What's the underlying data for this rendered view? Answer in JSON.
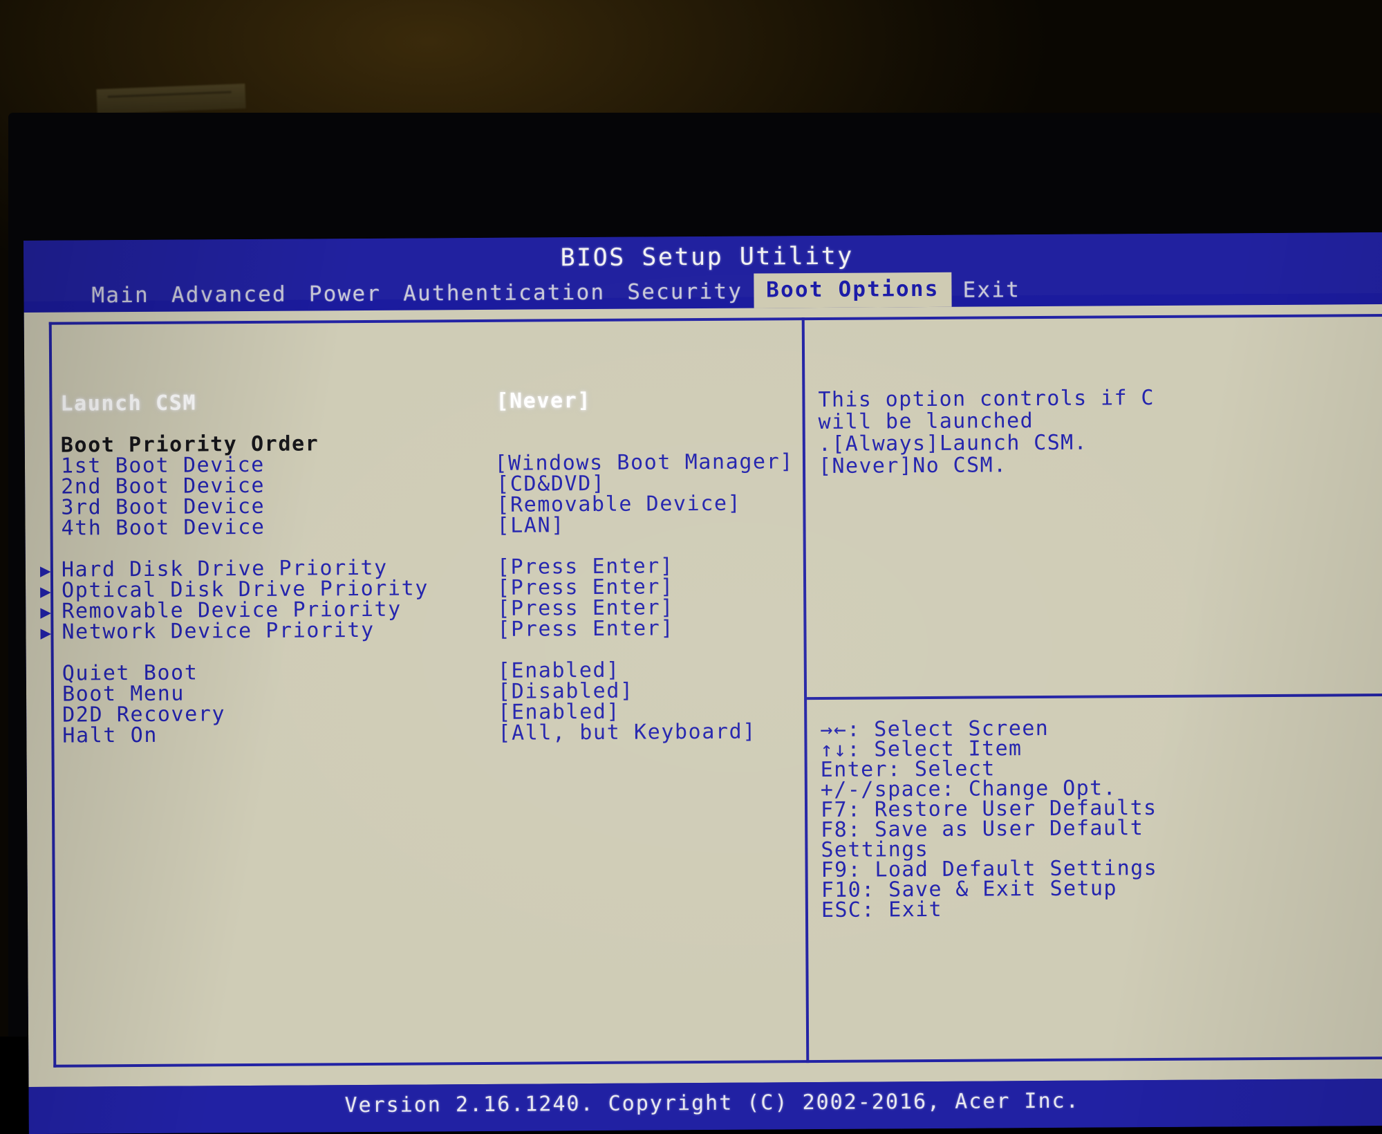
{
  "title": "BIOS Setup Utility",
  "menu": {
    "items": [
      {
        "label": "Main",
        "active": false
      },
      {
        "label": "Advanced",
        "active": false
      },
      {
        "label": "Power",
        "active": false
      },
      {
        "label": "Authentication",
        "active": false
      },
      {
        "label": "Security",
        "active": false
      },
      {
        "label": "Boot Options",
        "active": true
      },
      {
        "label": "Exit",
        "active": false
      }
    ]
  },
  "settings": [
    {
      "label": "Launch CSM",
      "value": "[Never]",
      "kind": "option",
      "selected": true,
      "submenu": false
    },
    {
      "label": "",
      "value": "",
      "kind": "spacer",
      "selected": false,
      "submenu": false
    },
    {
      "label": "Boot Priority Order",
      "value": "",
      "kind": "header",
      "selected": false,
      "submenu": false
    },
    {
      "label": "1st Boot Device",
      "value": "[Windows Boot Manager]",
      "kind": "option",
      "selected": false,
      "submenu": false
    },
    {
      "label": "2nd Boot Device",
      "value": "[CD&DVD]",
      "kind": "option",
      "selected": false,
      "submenu": false
    },
    {
      "label": "3rd Boot Device",
      "value": "[Removable Device]",
      "kind": "option",
      "selected": false,
      "submenu": false
    },
    {
      "label": "4th Boot Device",
      "value": "[LAN]",
      "kind": "option",
      "selected": false,
      "submenu": false
    },
    {
      "label": "",
      "value": "",
      "kind": "spacer",
      "selected": false,
      "submenu": false
    },
    {
      "label": "Hard Disk Drive Priority",
      "value": "[Press Enter]",
      "kind": "option",
      "selected": false,
      "submenu": true
    },
    {
      "label": "Optical Disk Drive Priority",
      "value": "[Press Enter]",
      "kind": "option",
      "selected": false,
      "submenu": true
    },
    {
      "label": "Removable Device Priority",
      "value": "[Press Enter]",
      "kind": "option",
      "selected": false,
      "submenu": true
    },
    {
      "label": "Network Device Priority",
      "value": "[Press Enter]",
      "kind": "option",
      "selected": false,
      "submenu": true
    },
    {
      "label": "",
      "value": "",
      "kind": "spacer",
      "selected": false,
      "submenu": false
    },
    {
      "label": "Quiet Boot",
      "value": "[Enabled]",
      "kind": "option",
      "selected": false,
      "submenu": false
    },
    {
      "label": "Boot Menu",
      "value": "[Disabled]",
      "kind": "option",
      "selected": false,
      "submenu": false
    },
    {
      "label": "D2D Recovery",
      "value": "[Enabled]",
      "kind": "option",
      "selected": false,
      "submenu": false
    },
    {
      "label": "Halt On",
      "value": "[All, but Keyboard]",
      "kind": "option",
      "selected": false,
      "submenu": false
    }
  ],
  "help": {
    "lines": [
      "This option controls if C",
      "will be launched",
      ".[Always]Launch CSM.",
      "[Never]No CSM."
    ]
  },
  "keys": {
    "lines": [
      "→←: Select Screen",
      "↑↓: Select Item",
      "Enter: Select",
      "+/-/space: Change Opt.",
      "F7: Restore User Defaults",
      "F8: Save as User Default",
      "Settings",
      "F9: Load Default Settings",
      "F10: Save & Exit Setup",
      "ESC: Exit"
    ]
  },
  "footer": {
    "text": "Version 2.16.1240. Copyright (C) 2002-2016, Acer Inc."
  },
  "icons": {
    "submenu_arrow": "▶"
  },
  "colors": {
    "screen_blue": "#21219f",
    "panel_beige": "#cfccb6",
    "text_blue": "#2222ad",
    "text_selected": "#ffffff",
    "header_black": "#16161a"
  }
}
